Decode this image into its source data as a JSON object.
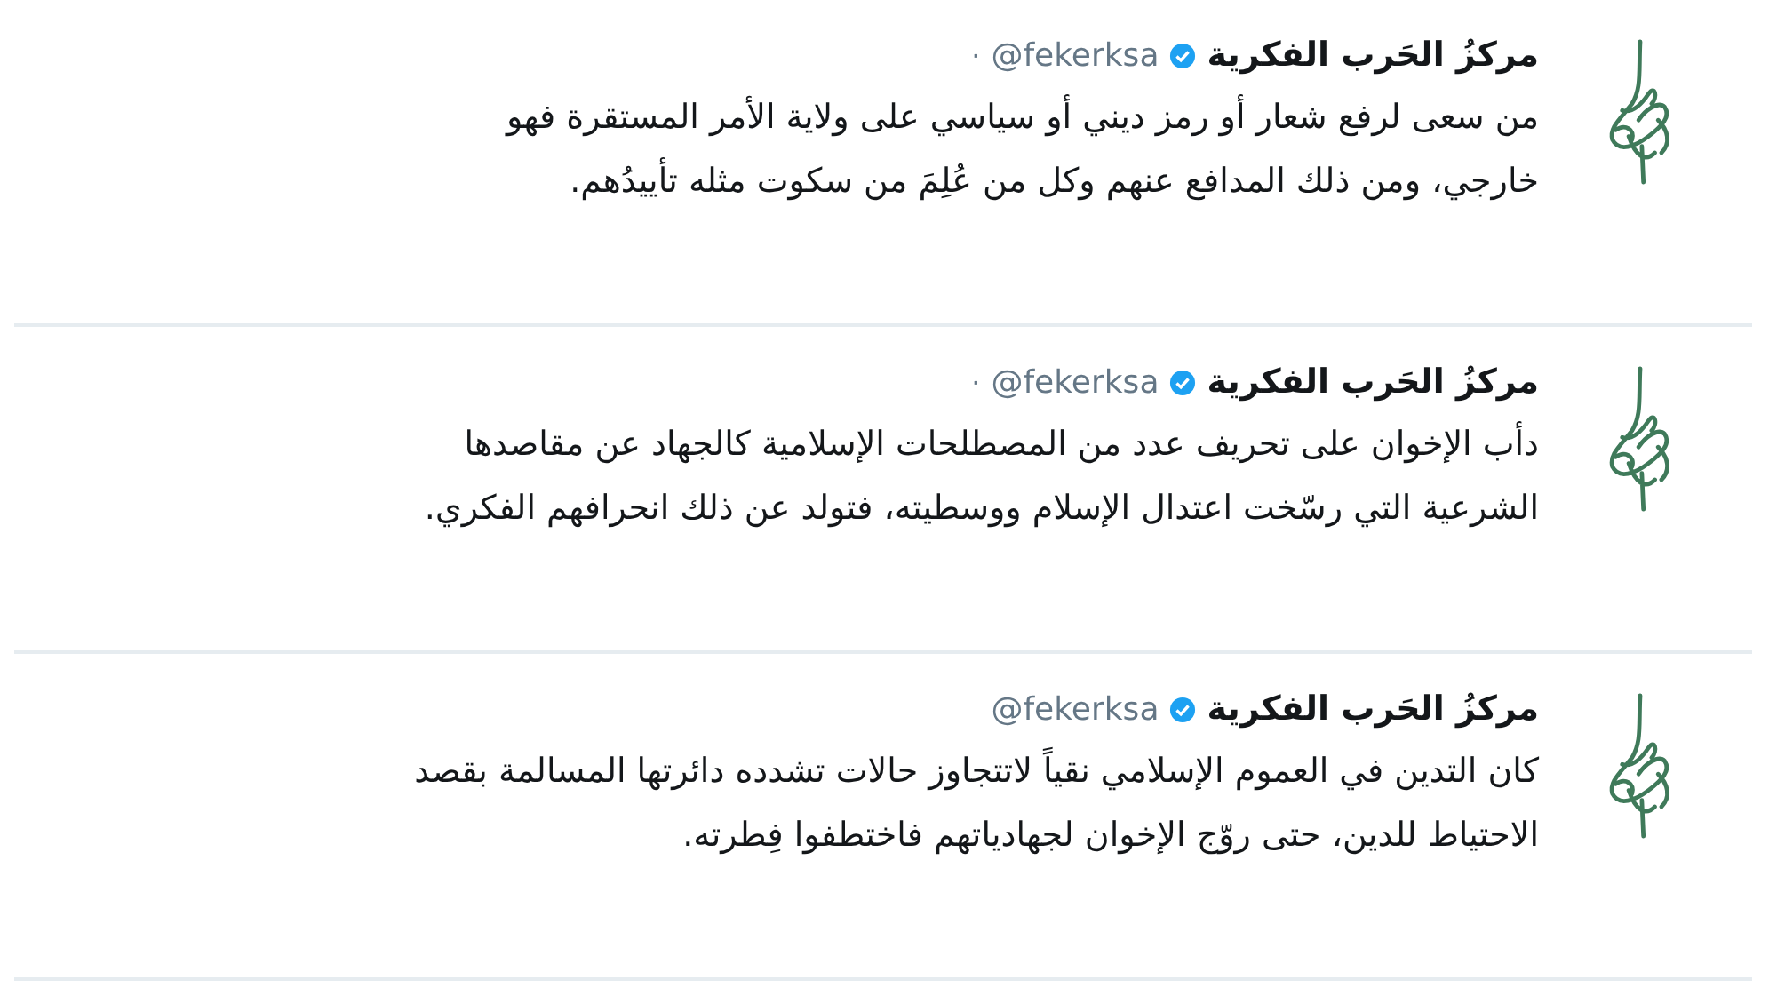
{
  "tweets": [
    {
      "name": "مركزُ الحَرب الفكرية",
      "verified": true,
      "handle": "@fekerksa",
      "dot": "·",
      "lines": [
        "من سعى لرفع شعار أو رمز ديني أو سياسي على ولاية الأمر المستقرة فهو",
        "خارجي، ومن ذلك المدافع عنهم وكل من عُلِمَ من سكوت مثله تأييدُهم."
      ]
    },
    {
      "name": "مركزُ الحَرب الفكرية",
      "verified": true,
      "handle": "@fekerksa",
      "dot": "·",
      "lines": [
        "دأب الإخوان على تحريف عدد من المصطلحات الإسلامية كالجهاد عن مقاصدها",
        "الشرعية التي رسّخت اعتدال الإسلام ووسطيته، فتولد عن ذلك انحرافهم الفكري."
      ]
    },
    {
      "name": "مركزُ الحَرب الفكرية",
      "verified": true,
      "handle": "@fekerksa",
      "lines": [
        "كان التدين في العموم الإسلامي نقياً لاتتجاوز حالات تشدده دائرتها المسالمة بقصد",
        "الاحتياط للدين، حتى روّج الإخوان لجهادياتهم فاختطفوا فِطرته."
      ]
    }
  ]
}
